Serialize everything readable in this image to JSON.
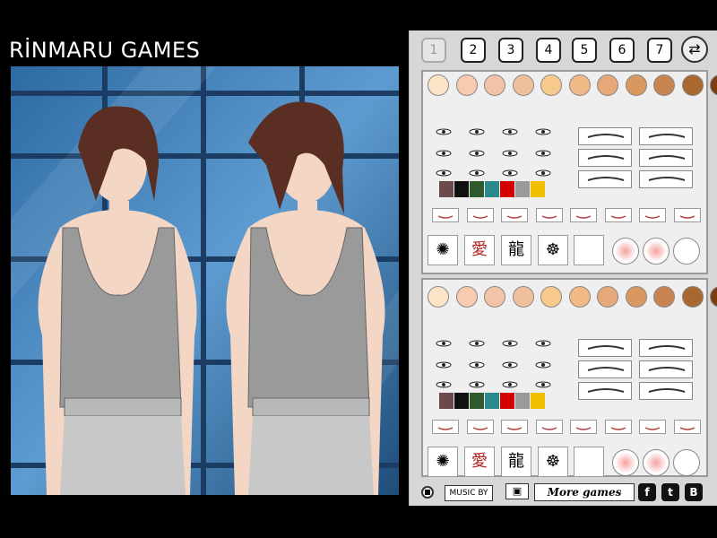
{
  "title": "RİNMARU GAMES",
  "tabs": [
    "1",
    "2",
    "3",
    "4",
    "5",
    "6",
    "7"
  ],
  "active_tab": "1",
  "swap_icon": "swap-characters-icon",
  "skin_tones": [
    "#fde3c8",
    "#f6cbb0",
    "#f2c3a6",
    "#f0c09c",
    "#f7c98c",
    "#f0b985",
    "#e6a878",
    "#d9985f",
    "#c88450",
    "#a9682f",
    "#7b3e12"
  ],
  "eye_colors": [
    "#6a4a4a",
    "#111111",
    "#2e5a2e",
    "#2a8a8a",
    "#d40000",
    "#9a9a9a",
    "#f0c000"
  ],
  "bottom": {
    "music_label": "MUSIC BY",
    "more_games_label": "More games",
    "facebook": "f",
    "twitter": "t",
    "blogger": "B"
  }
}
